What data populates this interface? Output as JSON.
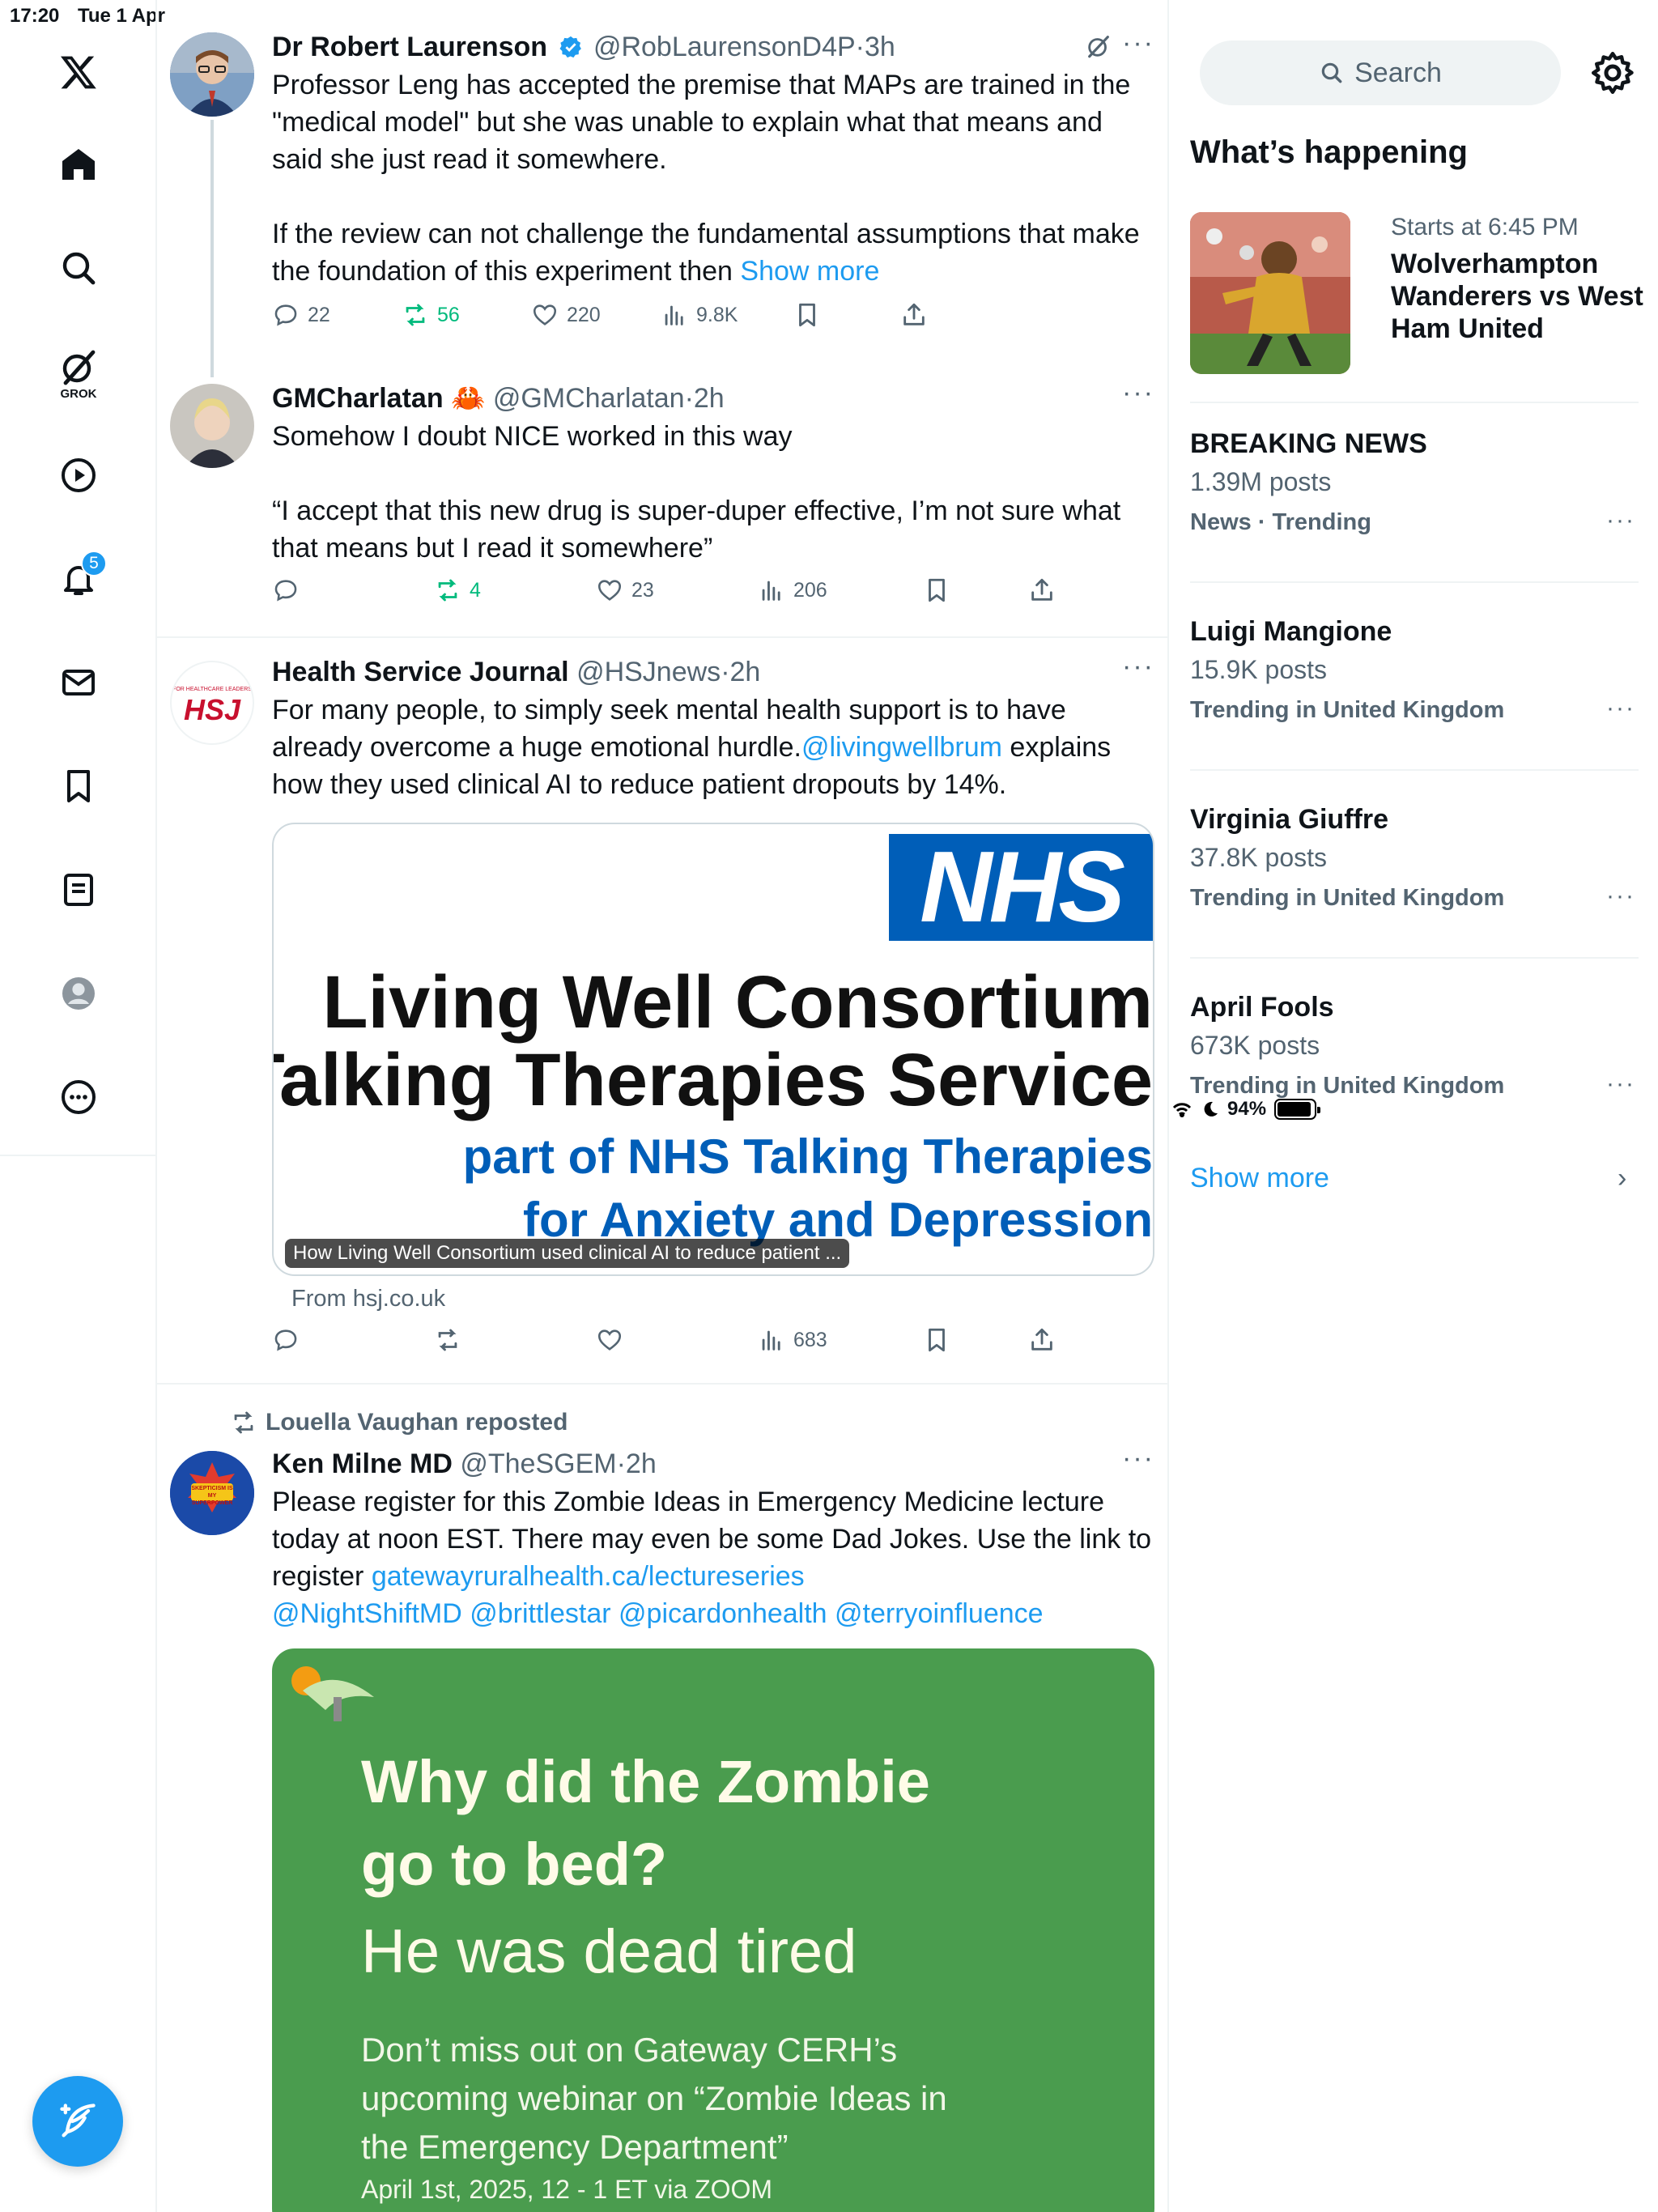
{
  "status": {
    "time": "17:20",
    "date": "Tue 1 Apr",
    "battery": "94%",
    "battery_level": 0.94
  },
  "nav": {
    "grok_label": "GROK",
    "notifications_badge": "5"
  },
  "timeline": {
    "tweets": [
      {
        "name": "Dr Robert Laurenson",
        "handle": "@RobLaurensonD4P",
        "time": "3h",
        "text_lines": [
          "Professor Leng has accepted the premise that MAPs are trained in the",
          "\"medical model\" but she was unable to explain what that means and",
          "said she just read it somewhere.",
          "",
          "If the review can not challenge the fundamental assumptions that make",
          "the foundation of this experiment then "
        ],
        "show_more": "Show more",
        "replies": "22",
        "reposts": "56",
        "likes": "220",
        "views": "9.8K"
      },
      {
        "name": "GMCharlatan",
        "emoji": "🦀",
        "handle": "@GMCharlatan",
        "time": "2h",
        "text_lines": [
          "Somehow I doubt NICE worked in this way",
          "",
          "“I accept that this new drug is super-duper effective, I’m not sure what",
          "that means but I read it somewhere”"
        ],
        "reposts": "4",
        "likes": "23",
        "views": "206"
      },
      {
        "name": "Health Service Journal",
        "handle": "@HSJnews",
        "time": "2h",
        "avatar_text": "HSJ",
        "avatar_tagline": "FOR HEALTHCARE LEADERS",
        "text_line1": "For many people, to simply seek mental health support is to have",
        "text_line2_a": "already overcome a huge emotional hurdle.",
        "text_line2_link": "@livingwellbrum",
        "text_line2_b": " explains",
        "text_line3": "how they used clinical AI to reduce patient dropouts by 14%.",
        "card": {
          "nhs": "NHS",
          "title1": "Living Well Consortium",
          "title2": "Talking Therapies Service",
          "sub1": "part of NHS Talking Therapies",
          "sub2": "for Anxiety and Depression",
          "caption": "How Living Well Consortium used clinical AI to reduce patient ...",
          "source": "From hsj.co.uk"
        },
        "views": "683"
      },
      {
        "reposted_by": "Louella Vaughan reposted",
        "name": "Ken Milne MD",
        "handle": "@TheSGEM",
        "time": "2h",
        "avatar_text": "SKEPTICISM IS MY SUPERPOWER",
        "text_line1": "Please register for this Zombie Ideas in Emergency Medicine lecture",
        "text_line2": "today at noon EST. There may even be some Dad Jokes.  Use the link to",
        "text_line3_a": "register ",
        "text_line3_link": "gatewayruralhealth.ca/lectureseries",
        "mentions": "@NightShiftMD @brittlestar @picardonhealth @terryoinfluence",
        "card": {
          "q1": "Why did the Zombie",
          "q2": "go to bed?",
          "answer": "He was dead tired",
          "promo1": "Don’t miss out on Gateway CERH’s",
          "promo2": "upcoming webinar on “Zombie Ideas in",
          "promo3": "the Emergency Department”",
          "date": "April 1st, 2025, 12 - 1 ET via ZOOM"
        }
      }
    ]
  },
  "sidebar": {
    "search_label": "Search",
    "title": "What’s happening",
    "event": {
      "when": "Starts at 6:45 PM",
      "what": "Wolverhampton Wanderers vs West Ham United"
    },
    "trends": [
      {
        "name": "BREAKING NEWS",
        "posts": "1.39M posts",
        "category": "News · Trending"
      },
      {
        "name": "Luigi Mangione",
        "posts": "15.9K posts",
        "category": "Trending in United Kingdom"
      },
      {
        "name": "Virginia Giuffre",
        "posts": "37.8K posts",
        "category": "Trending in United Kingdom"
      },
      {
        "name": "April Fools",
        "posts": "673K posts",
        "category": "Trending in United Kingdom"
      }
    ],
    "show_more": "Show more"
  },
  "colors": {
    "accent": "#1d9bf0",
    "repost_green": "#00ba7c",
    "nhs_blue": "#005eb8",
    "zombie_green": "#4a9c4e"
  }
}
